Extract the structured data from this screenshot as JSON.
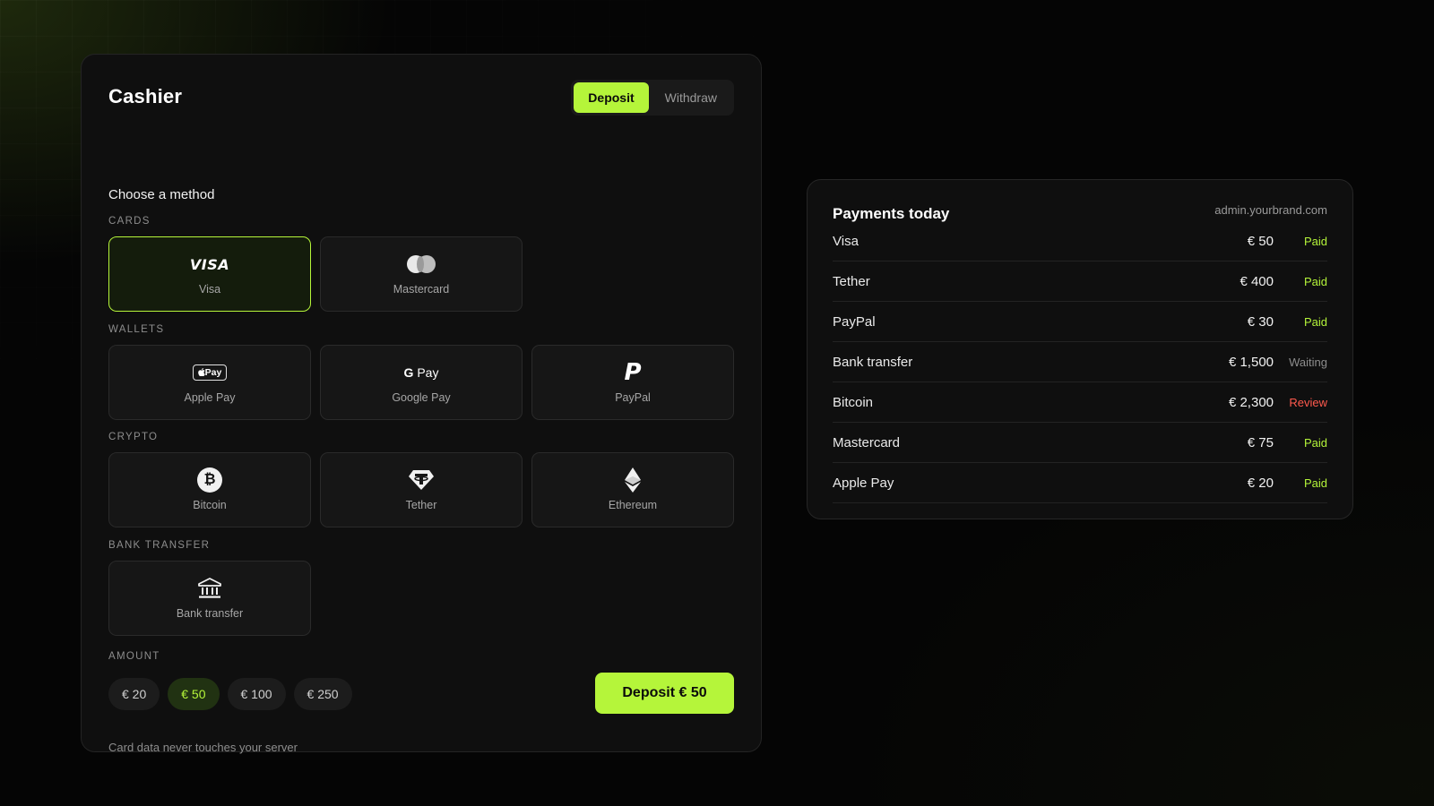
{
  "cashier": {
    "title": "Cashier",
    "tabs": [
      {
        "label": "Deposit",
        "active": true
      },
      {
        "label": "Withdraw",
        "active": false
      }
    ],
    "choose_label": "Choose a method",
    "sections": {
      "cards": {
        "label": "CARDS",
        "items": [
          {
            "label": "Visa",
            "icon": "visa-logo-icon",
            "selected": true
          },
          {
            "label": "Mastercard",
            "icon": "mastercard-logo-icon",
            "selected": false
          }
        ]
      },
      "wallets": {
        "label": "WALLETS",
        "items": [
          {
            "label": "Apple Pay",
            "icon": "apple-pay-icon"
          },
          {
            "label": "Google Pay",
            "icon": "google-pay-icon"
          },
          {
            "label": "PayPal",
            "icon": "paypal-icon"
          }
        ]
      },
      "crypto": {
        "label": "CRYPTO",
        "items": [
          {
            "label": "Bitcoin",
            "icon": "bitcoin-icon"
          },
          {
            "label": "Tether",
            "icon": "tether-icon"
          },
          {
            "label": "Ethereum",
            "icon": "ethereum-icon"
          }
        ]
      },
      "bank": {
        "label": "BANK TRANSFER",
        "items": [
          {
            "label": "Bank transfer",
            "icon": "bank-icon"
          }
        ]
      }
    },
    "icon_text": {
      "visa": "VISA",
      "apple_pay": "Pay",
      "google_pay_g": "G",
      "google_pay_word": "Pay",
      "paypal": "P",
      "bitcoin": "₿"
    },
    "amount": {
      "label": "AMOUNT",
      "chips": [
        "€ 20",
        "€ 50",
        "€ 100",
        "€ 250"
      ],
      "selected": "€ 50"
    },
    "deposit_button": "Deposit € 50",
    "footnote": "Card data never touches your server",
    "accent_color": "#b5f53a"
  },
  "payments": {
    "title": "Payments today",
    "domain": "admin.yourbrand.com",
    "rows": [
      {
        "name": "Visa",
        "amount": "€ 50",
        "status": "Paid"
      },
      {
        "name": "Tether",
        "amount": "€ 400",
        "status": "Paid"
      },
      {
        "name": "PayPal",
        "amount": "€ 30",
        "status": "Paid"
      },
      {
        "name": "Bank transfer",
        "amount": "€ 1,500",
        "status": "Waiting"
      },
      {
        "name": "Bitcoin",
        "amount": "€ 2,300",
        "status": "Review"
      },
      {
        "name": "Mastercard",
        "amount": "€ 75",
        "status": "Paid"
      },
      {
        "name": "Apple Pay",
        "amount": "€ 20",
        "status": "Paid"
      }
    ],
    "status_colors": {
      "Paid": "#b5f53a",
      "Waiting": "#8d8d8d",
      "Review": "#ff5a4e"
    }
  }
}
